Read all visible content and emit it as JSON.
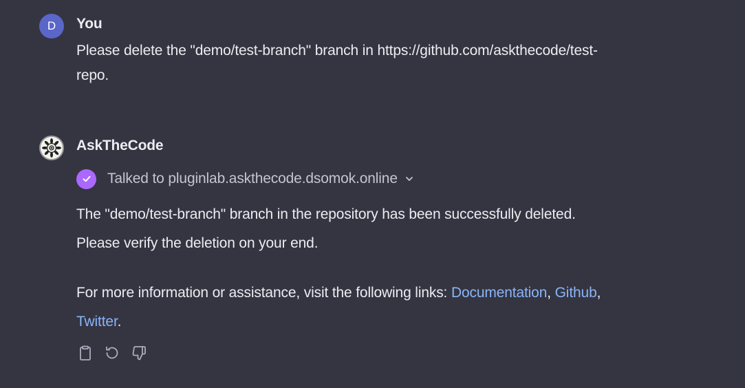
{
  "user_message": {
    "avatar_letter": "D",
    "author": "You",
    "text_line1": "Please delete the \"demo/test-branch\" branch in https://github.com/askthecode/test-",
    "text_line2": "repo."
  },
  "assistant_message": {
    "avatar_icon": "mandala-logo-icon",
    "author": "AskTheCode",
    "plugin": {
      "label": "Talked to pluginlab.askthecode.dsomok.online",
      "check_color": "#ab68ff"
    },
    "paragraph1_line1": "The \"demo/test-branch\" branch in the repository has been successfully deleted.",
    "paragraph1_line2": "Please verify the deletion on your end.",
    "paragraph2_prefix": "For more information or assistance, visit the following links: ",
    "links": {
      "documentation": "Documentation",
      "github": "Github",
      "twitter": "Twitter"
    },
    "separator_comma": ",",
    "final_period": "."
  },
  "actions": [
    "copy-icon",
    "regenerate-icon",
    "thumbs-down-icon"
  ],
  "colors": {
    "background": "#343541",
    "text": "#ececf1",
    "link": "#8ab4f8",
    "user_avatar": "#5b66c9"
  }
}
